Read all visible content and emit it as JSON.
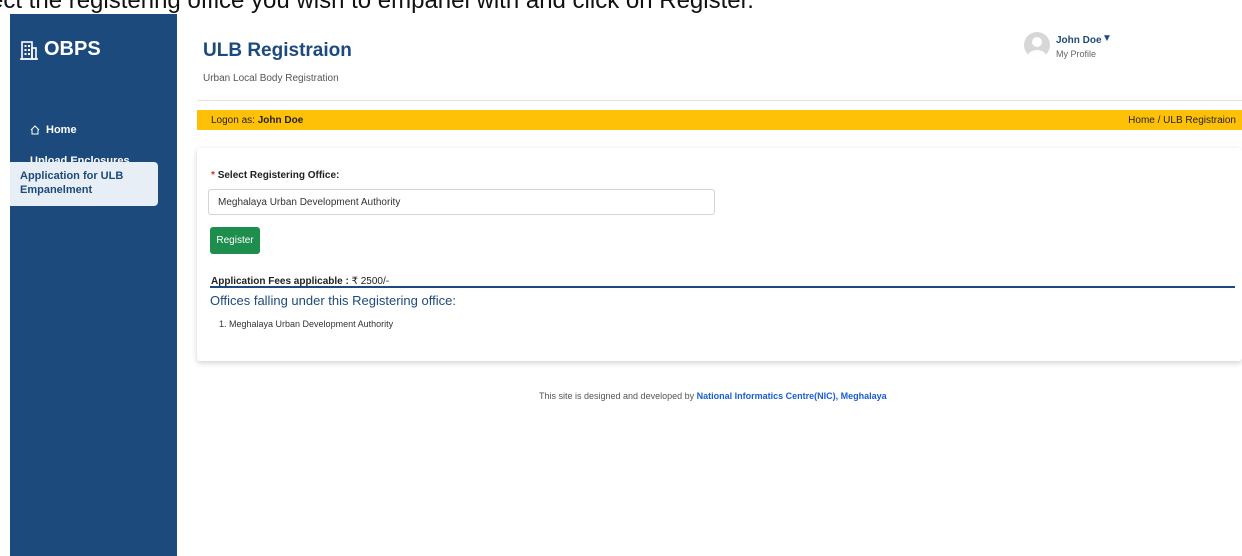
{
  "instruction": "ect the registering office you wish to empanel with and click on Register.",
  "sidebar": {
    "brand": "OBPS",
    "items": [
      {
        "label": "Home"
      },
      {
        "label": "Upload Enclosures"
      },
      {
        "label": "Application for ULB Empanelment"
      }
    ]
  },
  "header": {
    "title": "ULB Registraion",
    "subtitle": "Urban Local Body Registration",
    "user_name": "John Doe",
    "user_menu": "My Profile"
  },
  "logon_bar": {
    "prefix": "Logon as:",
    "user": "John Doe",
    "breadcrumb": "Home / ULB Registraion"
  },
  "form": {
    "required_mark": "*",
    "label": "Select Registering Office:",
    "selected_office": "Meghalaya Urban Development Authority",
    "register_label": "Register",
    "fees_label": "Application Fees applicable :",
    "fees_value": "₹ 2500/-",
    "offices_title": "Offices falling under this Registering office:",
    "offices": [
      "1. Meghalaya Urban Development Authority"
    ]
  },
  "footer": {
    "text": "This site is designed and developed by",
    "org": "National Informatics Centre(NIC), Meghalaya"
  },
  "colors": {
    "sidebar": "#1d4a7c",
    "accent_yellow": "#ffc107",
    "register_green": "#1e8e4e",
    "link_blue": "#1a5dd6"
  }
}
